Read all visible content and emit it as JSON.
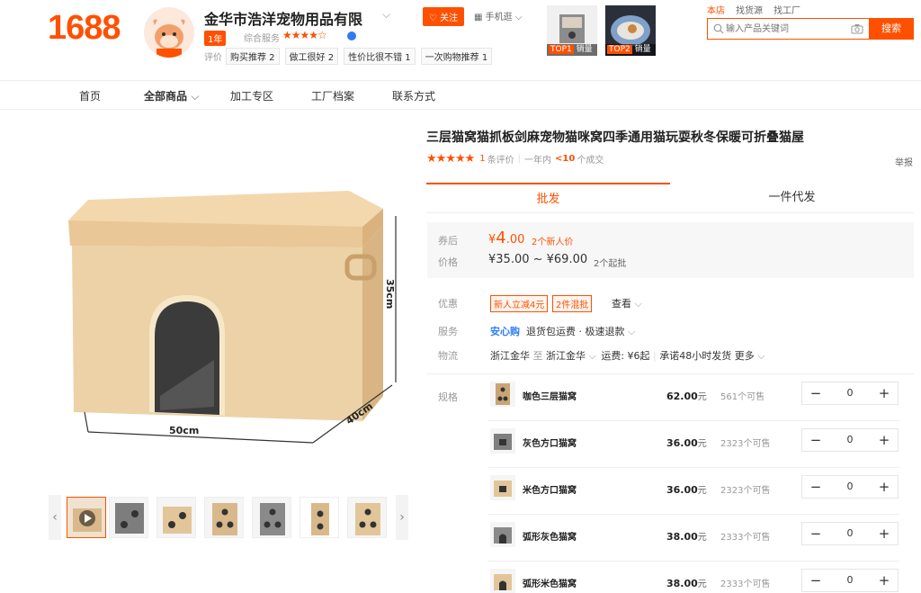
{
  "header": {
    "logo": "1688",
    "shop_name": "金华市浩洋宠物用品有限",
    "year_badge": "1年",
    "service_label": "综合服务",
    "service_stars": "★★★★☆",
    "eval_label": "评价",
    "eval_tags": [
      "购买推荐 2",
      "做工很好 2",
      "性价比很不错 1",
      "一次购物推荐 1"
    ],
    "follow_label": "关注",
    "mobile_label": "手机逛",
    "top_items": [
      {
        "rank": "TOP1",
        "text": "销量"
      },
      {
        "rank": "TOP2",
        "text": "销量"
      }
    ],
    "search_tabs": [
      "本店",
      "找货源",
      "找工厂"
    ],
    "search_placeholder": "输入产品关键词",
    "search_button": "搜索"
  },
  "nav": {
    "items": [
      "首页",
      "全部商品",
      "加工专区",
      "工厂档案",
      "联系方式"
    ]
  },
  "product": {
    "title": "三层猫窝猫抓板剑麻宠物猫咪窝四季通用猫玩耍秋冬保暖可折叠猫屋",
    "stars": "★★★★★",
    "review_count": "1",
    "review_label": "条评价",
    "deal_period": "一年内",
    "deal_count": "<10",
    "deal_label": "个成交",
    "report": "举报",
    "image_dims": {
      "width": "50cm",
      "depth": "40cm",
      "height": "35cm"
    }
  },
  "mode_tabs": [
    "批发",
    "一件代发"
  ],
  "price": {
    "after_coupon_label": "券后",
    "after_coupon_currency": "¥",
    "after_coupon_int": "4",
    "after_coupon_dec": ".00",
    "after_coupon_note": "2个新人价",
    "price_label": "价格",
    "price_range": "¥35.00 ~ ¥69.00",
    "min_order": "2个起批"
  },
  "attrs": {
    "promo_label": "优惠",
    "coupons": [
      "新人立减4元",
      "2件混批"
    ],
    "promo_more": "查看",
    "service_label": "服务",
    "service_safe": "安心购",
    "service_text": "退货包运费 · 极速退款",
    "logistics_label": "物流",
    "logistics_from": "浙江金华",
    "logistics_to_word": "至",
    "logistics_to": "浙江金华",
    "logistics_fee": "运费: ¥6起",
    "logistics_promise": "承诺48小时发货",
    "logistics_more": "更多"
  },
  "skus": {
    "label": "规格",
    "unit": "元",
    "rows": [
      {
        "name": "咖色三层猫窝",
        "price": "62.00",
        "stock": "561个可售",
        "qty": "0"
      },
      {
        "name": "灰色方口猫窝",
        "price": "36.00",
        "stock": "2323个可售",
        "qty": "0"
      },
      {
        "name": "米色方口猫窝",
        "price": "36.00",
        "stock": "2323个可售",
        "qty": "0"
      },
      {
        "name": "弧形灰色猫窝",
        "price": "38.00",
        "stock": "2333个可售",
        "qty": "0"
      },
      {
        "name": "弧形米色猫窝",
        "price": "38.00",
        "stock": "2333个可售",
        "qty": "0"
      }
    ]
  },
  "colors": {
    "accent": "#ff5000",
    "blue": "#2e7cf6"
  }
}
